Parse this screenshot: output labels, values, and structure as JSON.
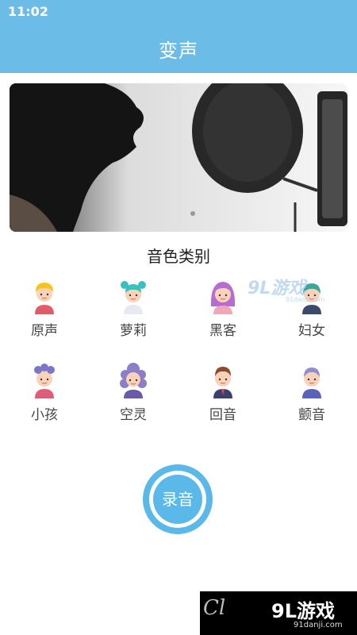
{
  "status_bar": {
    "time": "11:02"
  },
  "header": {
    "title": "变声"
  },
  "section": {
    "title": "音色类别"
  },
  "voices": [
    {
      "label": "原声",
      "icon": "boy-yellow-hair-icon"
    },
    {
      "label": "萝莉",
      "icon": "girl-teal-buns-icon"
    },
    {
      "label": "黑客",
      "icon": "woman-purple-hair-icon"
    },
    {
      "label": "妇女",
      "icon": "woman-teal-hair-icon"
    },
    {
      "label": "小孩",
      "icon": "child-purple-hair-icon"
    },
    {
      "label": "空灵",
      "icon": "woman-curly-purple-hair-icon"
    },
    {
      "label": "回音",
      "icon": "man-brown-hair-icon"
    },
    {
      "label": "颤音",
      "icon": "elder-purple-hair-icon"
    }
  ],
  "record_button": {
    "label": "录音"
  },
  "colors": {
    "header": "#6bbce6",
    "accent": "#5ab9e8"
  },
  "watermarks": {
    "top": {
      "big": "9L游戏",
      "small": "91danji.com"
    },
    "bottom": {
      "cl": "Cl",
      "logo": "9L游戏",
      "url": "91danji.com"
    }
  }
}
